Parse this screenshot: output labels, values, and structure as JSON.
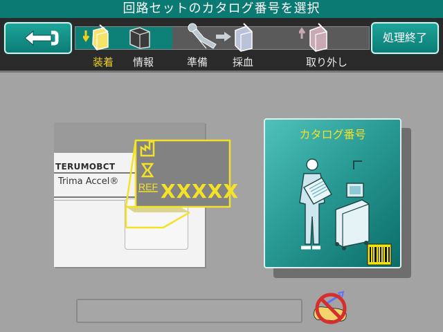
{
  "title": "回路セットのカタログ番号を選択",
  "header": {
    "back_icon": "return-arrow-icon",
    "end_button_label": "処理終了",
    "progress_fraction": 0.33
  },
  "steps": [
    {
      "label": "装着",
      "icon": "load-cassette-icon",
      "active": true
    },
    {
      "label": "情報",
      "icon": "info-folder-icon",
      "active": false
    },
    {
      "label": "準備",
      "icon": "prepare-donor-icon",
      "active": false
    },
    {
      "label": "採血",
      "icon": "collect-icon",
      "active": false
    },
    {
      "label": "取り外し",
      "icon": "unload-icon",
      "active": false
    }
  ],
  "label_card": {
    "brand": "TERUMOBCT",
    "model": "Trima Accel®",
    "ref_label": "REF",
    "ref_code": "XXXXX"
  },
  "catalog_button": {
    "label": "カタログ番号"
  },
  "status_field": {
    "value": ""
  },
  "icons": {
    "no_needle": "no-needle-icon"
  },
  "colors": {
    "teal": "#0b7a73",
    "accent_yellow": "#f0d020",
    "background": "#a3a3a3"
  }
}
